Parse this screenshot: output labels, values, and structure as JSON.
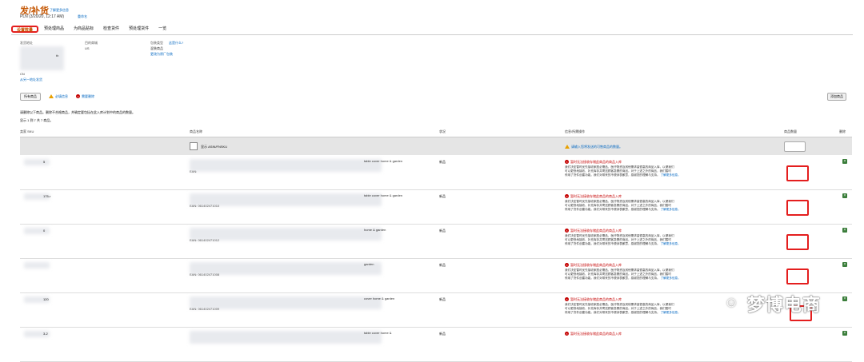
{
  "header": {
    "title": "发/补货",
    "learn_more": "了解更多信息",
    "plan": "PLN (3/20/20, 12:17 AM)",
    "rename": "重命名"
  },
  "tabs": [
    {
      "label": "设置数量"
    },
    {
      "label": "预处理商品"
    },
    {
      "label": "为商品贴标"
    },
    {
      "label": "检查货件"
    },
    {
      "label": "预处理货件"
    },
    {
      "label": "一览"
    }
  ],
  "info": {
    "ship_from_label": "发货地址",
    "ship_to_label": "目的商城",
    "ship_to_value": "US",
    "packing_label": "包装类型",
    "packing_link": "这是什么?",
    "packing_value": "混装商品",
    "packing_change": "更改为原厂包装",
    "ship_from_tail": "th",
    "country": "CN",
    "ship_from_link": "从另一地址发货"
  },
  "filters": {
    "all": "所有商品",
    "required": "必填信息",
    "remove": "需要删除"
  },
  "add_button": "添加商品",
  "note": "请删除以下商品。删除不合格商品，并确定要包括在此入库计划中的商品的数量。",
  "count": "显示 1 到 7 共 7 商品。",
  "columns": {
    "sku": "卖家 SKU",
    "title": "商品名称",
    "condition": "状况",
    "info": "信息/所需操作",
    "qty": "商品数量",
    "delete": "删除"
  },
  "grey_row": {
    "show_asin": "显示 ASIN/FNSKU",
    "warn": "请输入您将发送的可售商品的数量。"
  },
  "rows": [
    {
      "sku": "5",
      "title_tail": "table cover home & garden",
      "ean": "EAN:",
      "condition": "新品"
    },
    {
      "sku": "175-r",
      "title_tail": "table cover home & garden",
      "ean": "EAN: 061402471010",
      "condition": "新品"
    },
    {
      "sku": "0",
      "title_tail": "home & garden",
      "ean": "EAN: 061402471012",
      "condition": "新品"
    },
    {
      "sku": "",
      "title_tail": "garden",
      "ean": "EAN: 061402471008",
      "condition": "新品"
    },
    {
      "sku": "120",
      "title_tail": "cover home & garden",
      "ean": "EAN: 061402471009",
      "condition": "新品"
    },
    {
      "sku": "3-2",
      "title_tail": "table cover home &",
      "ean": "",
      "condition": "新品"
    }
  ],
  "error": {
    "heading": "暂时无法接收存储此商品的商品入库",
    "line1": "我们决定暂时优先接收家庭必需品、医疗物资及其他需求量很高的商品入库，以便我们",
    "line2": "可以更快地接收、补充库存并寄送顾客急需的商品。对于上述之外的商品，我们暂时",
    "line3": "停用了货件创建功能。我们对带来的不便深表歉意，感谢您的理解与支持。",
    "more": "了解更多信息。"
  },
  "watermark": "梦博电商"
}
